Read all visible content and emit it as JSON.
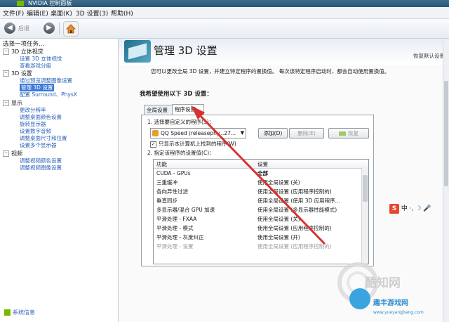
{
  "window": {
    "title": "NVIDIA 控制面板"
  },
  "menu": [
    "文件(F)",
    "编辑(E)",
    "桌面(K)",
    "3D 设置(3)",
    "帮助(H)"
  ],
  "toolbar": {
    "back_label": "后退"
  },
  "left": {
    "task_header": "选择一项任务...",
    "tree": [
      {
        "label": "3D 立体视觉",
        "children": [
          "设置 3D 立体视觉",
          "查看游戏分级"
        ]
      },
      {
        "label": "3D 设置",
        "children": [
          "通过预览调整图像设置",
          "管理 3D 设置",
          "配置 Surround、PhysX"
        ]
      },
      {
        "label": "显示",
        "children": [
          "更改分辨率",
          "调整桌面颜色设置",
          "旋转显示器",
          "设置数字音频",
          "调整桌面尺寸和位置",
          "设置多个显示器"
        ]
      },
      {
        "label": "视频",
        "children": [
          "调整视频颜色设置",
          "调整视频图像设置"
        ]
      }
    ],
    "system_info": "系统信息"
  },
  "main": {
    "title": "管理 3D 设置",
    "restore_defaults": "恢复默认设置",
    "intro": "您可以更改全局 3D 设置，并建立特定程序的置换值。 每次该特定程序启动时，都会自动使用置换值。",
    "section_heading": "我希望使用以下 3D 设置：",
    "tabs": [
      "全局设置",
      "程序设置"
    ],
    "step1": "1. 选择要自定义的程序(S)：",
    "program_selected": "QQ Speed (releasephy...27...",
    "buttons": {
      "add": "添加(D)",
      "remove": "删除(E)",
      "restore": "恢复"
    },
    "checkbox": "只显示本计算机上找到的程序(W)",
    "step2": "2. 指定该程序的设置值(C)：",
    "grid_headers": [
      "功能",
      "设置"
    ],
    "grid_rows": [
      [
        "CUDA - GPUs",
        "全部"
      ],
      [
        "三重缓冲",
        "使用全局设置 (关)"
      ],
      [
        "各向异性过滤",
        "使用全局设置 (应用程序控制的)"
      ],
      [
        "垂直同步",
        "使用全局设置 (使用 3D 应用程序..."
      ],
      [
        "多显示器/混合 GPU 加速",
        "使用全局设置 (多显示器性能模式)"
      ],
      [
        "平滑处理 - FXAA",
        "使用全局设置 (关)"
      ],
      [
        "平滑处理 - 模式",
        "使用全局设置 (应用程序控制的)"
      ],
      [
        "平滑处理 - 灰度纠正",
        "使用全局设置 (开)"
      ],
      [
        "平滑处理 - 设置",
        "使用全局设置 (应用程序控制的)"
      ]
    ]
  },
  "ime": {
    "label": "中"
  },
  "watermarks": {
    "brand": "酷知网",
    "site_cn": "趣丰游戏网",
    "site_url": "www.yueyangbang.com"
  },
  "colors": {
    "accent": "#76b900",
    "selection": "#3b78d8",
    "arrow": "#d8322f"
  }
}
